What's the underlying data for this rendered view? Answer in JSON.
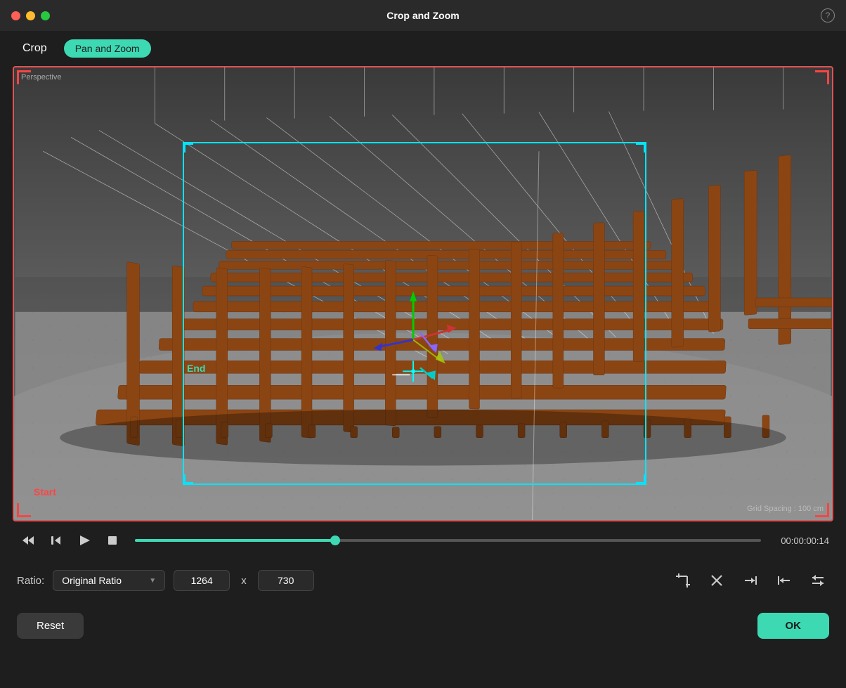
{
  "window": {
    "title": "Crop and Zoom",
    "help_icon": "?"
  },
  "tabs": {
    "crop_label": "Crop",
    "pan_zoom_label": "Pan and Zoom",
    "active": "pan_zoom"
  },
  "viewport": {
    "perspective_label": "Perspective",
    "start_label": "Start",
    "end_label": "End",
    "grid_spacing_label": "Grid Spacing : 100 cm"
  },
  "playback": {
    "time": "00:00:00:14"
  },
  "ratio": {
    "label": "Ratio:",
    "selected": "Original Ratio",
    "width": "1264",
    "height": "730",
    "x_sep": "x"
  },
  "actions": {
    "reset_label": "Reset",
    "ok_label": "OK"
  },
  "icons": {
    "skip_back": "⇤",
    "step_back": "⏮",
    "play": "▷",
    "stop": "□",
    "scissors_icon": "✂",
    "crop_cross_icon": "⤢",
    "close_icon": "✕",
    "arrow_right_icon": "→|",
    "arrow_left_icon": "|←",
    "swap_icon": "⇐"
  }
}
